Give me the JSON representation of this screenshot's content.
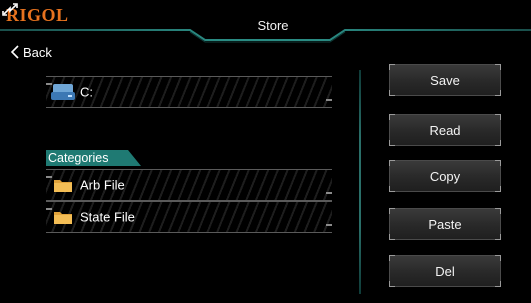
{
  "header": {
    "brand": "RIGOL",
    "title": "Store",
    "swap_icon": "swap-arrows-icon",
    "accent_color": "#2a8b83",
    "brand_color": "#e8731f"
  },
  "nav": {
    "back_label": "Back"
  },
  "browser": {
    "drives": [
      {
        "label": "C:",
        "icon": "drive-icon"
      }
    ],
    "categories_label": "Categories",
    "categories": [
      {
        "label": "Arb File",
        "icon": "folder-icon"
      },
      {
        "label": "State File",
        "icon": "folder-icon"
      }
    ]
  },
  "actions": {
    "save": "Save",
    "read": "Read",
    "copy": "Copy",
    "paste": "Paste",
    "del": "Del"
  }
}
